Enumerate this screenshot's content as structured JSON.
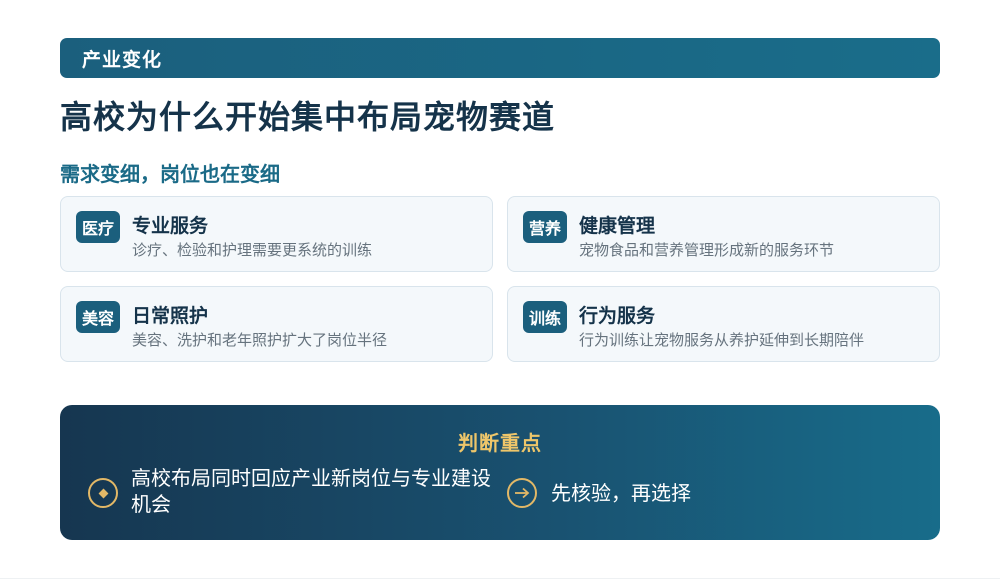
{
  "header": {
    "section_label": "产业变化"
  },
  "main": {
    "title": "高校为什么开始集中布局宠物赛道",
    "subtitle": "需求变细，岗位也在变细"
  },
  "cards": [
    {
      "badge": "医疗",
      "title": "专业服务",
      "desc": "诊疗、检验和护理需要更系统的训练"
    },
    {
      "badge": "营养",
      "title": "健康管理",
      "desc": "宠物食品和营养管理形成新的服务环节"
    },
    {
      "badge": "美容",
      "title": "日常照护",
      "desc": "美容、洗护和老年照护扩大了岗位半径"
    },
    {
      "badge": "训练",
      "title": "行为服务",
      "desc": "行为训练让宠物服务从养护延伸到长期陪伴"
    }
  ],
  "summary": {
    "title": "判断重点",
    "points": [
      {
        "icon": "diamond-icon",
        "text": "高校布局同时回应产业新岗位与专业建设机会"
      },
      {
        "icon": "arrow-right-icon",
        "text": "先核验，再选择"
      }
    ]
  },
  "colors": {
    "primary": "#1b5f7d",
    "title": "#15334a",
    "accent_gold": "#eec66a",
    "card_bg": "#f4f8fb"
  }
}
